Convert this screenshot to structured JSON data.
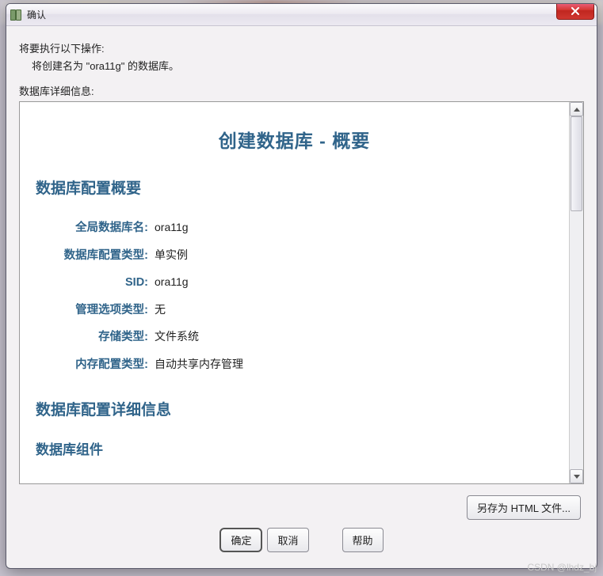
{
  "window": {
    "title": "确认"
  },
  "intro": {
    "line1": "将要执行以下操作:",
    "line2": "将创建名为 \"ora11g\" 的数据库。",
    "detail_label": "数据库详细信息:"
  },
  "summary": {
    "title": "创建数据库 - 概要",
    "config_heading": "数据库配置概要",
    "rows": [
      {
        "key": "全局数据库名:",
        "val": "ora11g"
      },
      {
        "key": "数据库配置类型:",
        "val": "单实例"
      },
      {
        "key": "SID:",
        "val": "ora11g"
      },
      {
        "key": "管理选项类型:",
        "val": "无"
      },
      {
        "key": "存储类型:",
        "val": "文件系统"
      },
      {
        "key": "内存配置类型:",
        "val": "自动共享内存管理"
      }
    ],
    "detail_heading": "数据库配置详细信息",
    "components_heading": "数据库组件"
  },
  "buttons": {
    "save_html": "另存为 HTML 文件...",
    "ok": "确定",
    "cancel": "取消",
    "help": "帮助"
  },
  "watermark": "CSDN @lhdz_bj"
}
